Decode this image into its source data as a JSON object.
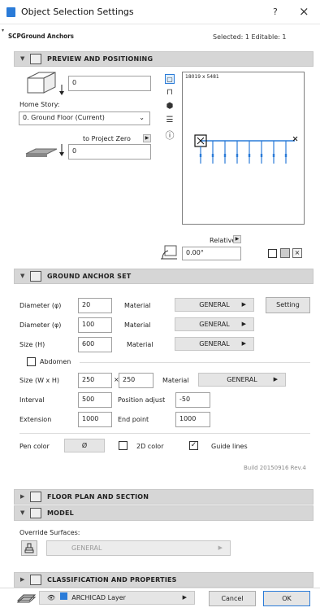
{
  "window": {
    "title": "Object Selection Settings",
    "help": "?",
    "close": "×"
  },
  "header": {
    "object_name": "SCPGround Anchors",
    "selection_info": "Selected: 1 Editable: 1"
  },
  "preview_section": {
    "title": "PREVIEW AND POSITIONING",
    "elevation_value": "0",
    "home_story_label": "Home Story:",
    "home_story_value": "0. Ground Floor (Current)",
    "to_project_zero_label": "to Project Zero",
    "project_zero_value": "0",
    "preview_dims": "18019 x 5481",
    "relative_label": "Relative",
    "rotation_value": "0.00°"
  },
  "anchor_section": {
    "title": "GROUND ANCHOR SET",
    "diameter1_label": "Diameter (φ)",
    "diameter1_value": "20",
    "material1_label": "Material",
    "material1_value": "GENERAL",
    "setting_label": "Setting",
    "diameter2_label": "Diameter (φ)",
    "diameter2_value": "100",
    "material2_label": "Material",
    "material2_value": "GENERAL",
    "size_h_label": "Size (H)",
    "size_h_value": "600",
    "material3_label": "Material",
    "material3_value": "GENERAL",
    "abdomen_label": "Abdomen",
    "size_wxh_label": "Size (W x H)",
    "size_w_value": "250",
    "size_x": "×",
    "size_h2_value": "250",
    "material4_label": "Material",
    "material4_value": "GENERAL",
    "interval_label": "Interval",
    "interval_value": "500",
    "position_adjust_label": "Position adjust",
    "position_adjust_value": "-50",
    "extension_label": "Extension",
    "extension_value": "1000",
    "end_point_label": "End point",
    "end_point_value": "1000",
    "pen_color_label": "Pen color",
    "pen_color_value": "Ø",
    "color2d_label": "2D color",
    "guide_lines_label": "Guide lines",
    "build_info": "Build 20150916 Rev.4"
  },
  "floor_section": {
    "title": "FLOOR PLAN AND SECTION"
  },
  "model_section": {
    "title": "MODEL",
    "override_label": "Override Surfaces:",
    "surface_value": "GENERAL"
  },
  "classification_section": {
    "title": "CLASSIFICATION AND PROPERTIES"
  },
  "footer": {
    "layer_value": "ARCHICAD Layer",
    "cancel_label": "Cancel",
    "ok_label": "OK"
  }
}
